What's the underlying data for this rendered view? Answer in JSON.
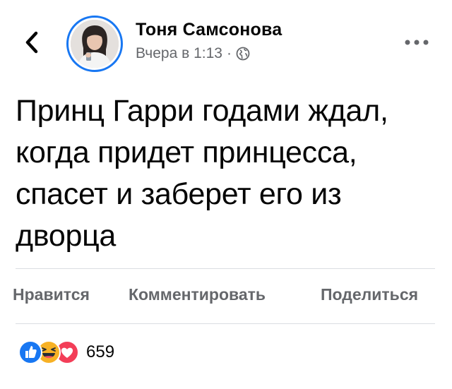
{
  "header": {
    "author_name": "Тоня Самсонова",
    "timestamp": "Вчера в 1:13",
    "separator": "·",
    "privacy_icon": "globe-icon",
    "back_icon": "chevron-left-icon",
    "more_icon": "more-dots-icon"
  },
  "post": {
    "lines": [
      "Принц Гарри годами ждал,",
      "когда придет принцесса,",
      "спасет и заберет его из",
      "дворца"
    ]
  },
  "actions": {
    "like_label": "Нравится",
    "comment_label": "Комментировать",
    "share_label": "Поделиться"
  },
  "reactions": {
    "types": [
      "like-icon",
      "haha-icon",
      "love-icon"
    ],
    "count": "659"
  },
  "colors": {
    "accent": "#1877f2",
    "secondary_text": "#65676b",
    "divider": "#dadde1",
    "love": "#f33e58",
    "haha": "#f7b125"
  }
}
